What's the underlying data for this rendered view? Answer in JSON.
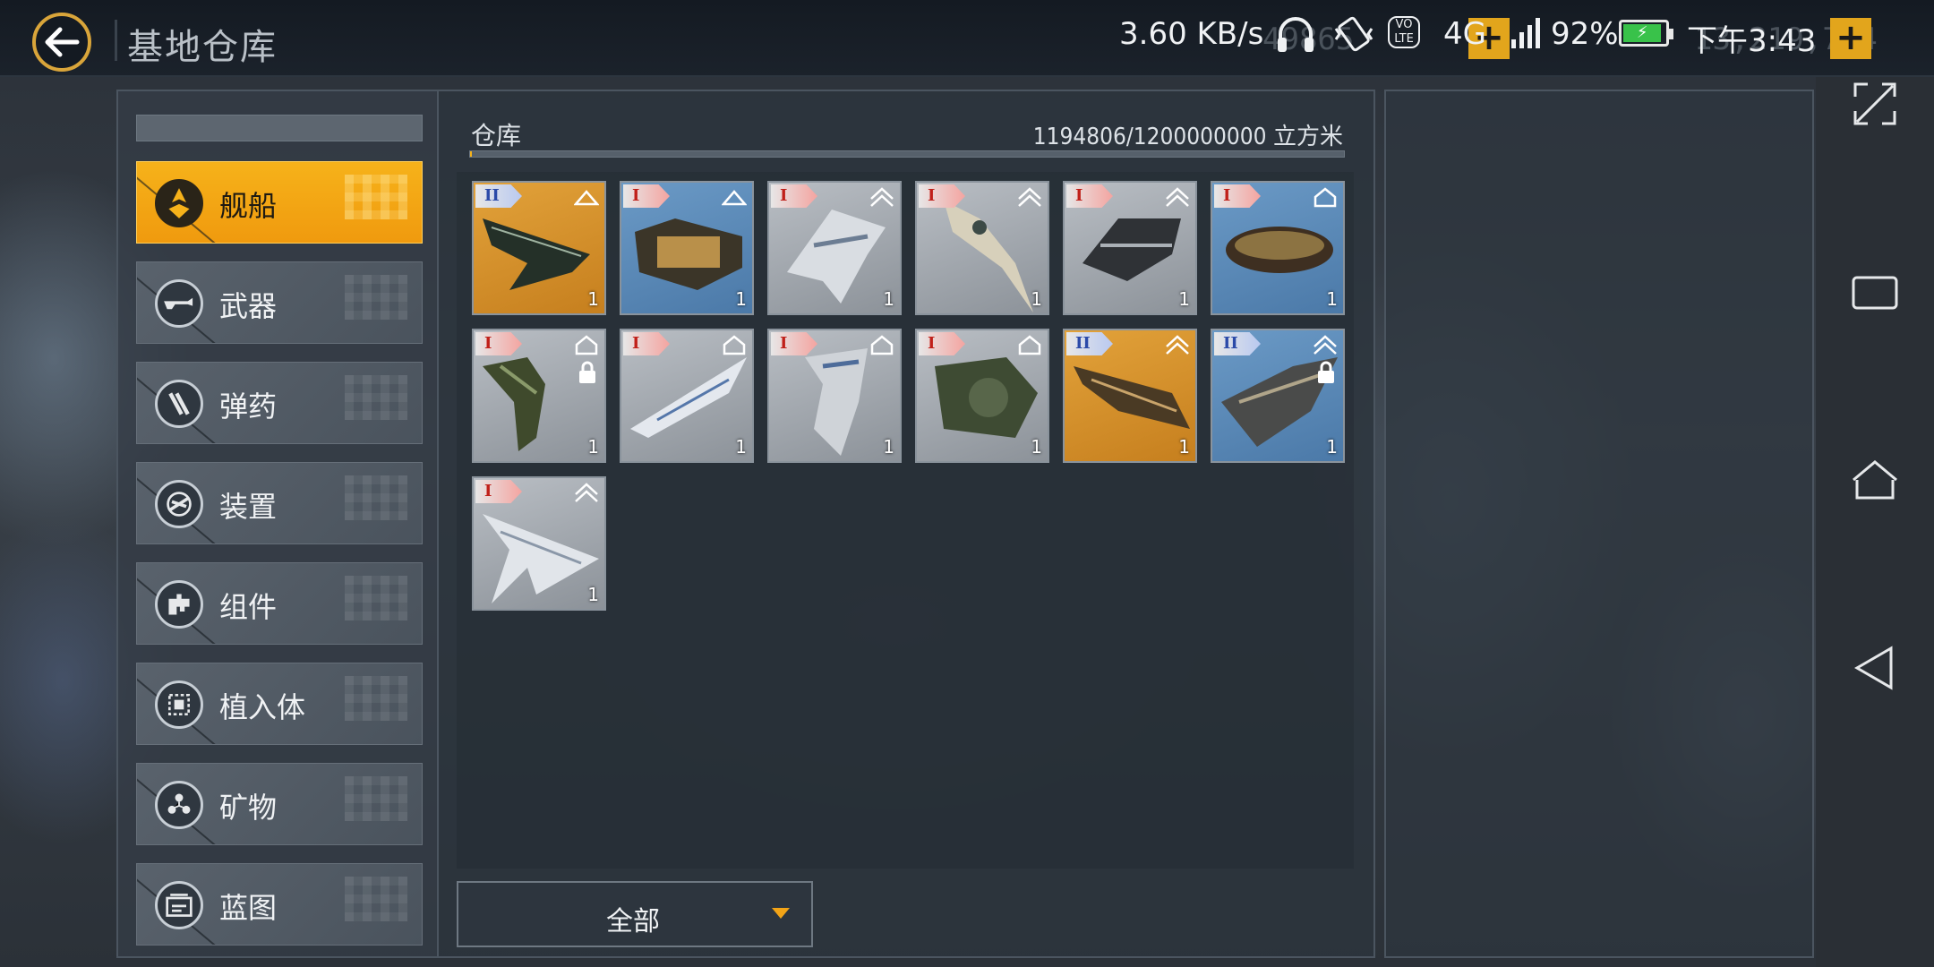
{
  "header": {
    "title": "基地仓库",
    "currency_ghost_left": "49865",
    "currency_ghost_right": "13,219,734"
  },
  "status_bar": {
    "network_speed": "3.60 KB/s",
    "volte_label": "VO LTE",
    "network_type": "4G",
    "battery_percent": "92%",
    "time": "下午3:43"
  },
  "sidebar": {
    "items": [
      {
        "label": "舰船",
        "icon": "ship-category-icon",
        "active": true
      },
      {
        "label": "武器",
        "icon": "weapon-category-icon",
        "active": false
      },
      {
        "label": "弹药",
        "icon": "ammo-category-icon",
        "active": false
      },
      {
        "label": "装置",
        "icon": "device-category-icon",
        "active": false
      },
      {
        "label": "组件",
        "icon": "component-category-icon",
        "active": false
      },
      {
        "label": "植入体",
        "icon": "implant-category-icon",
        "active": false
      },
      {
        "label": "矿物",
        "icon": "mineral-category-icon",
        "active": false
      },
      {
        "label": "蓝图",
        "icon": "blueprint-category-icon",
        "active": false
      }
    ]
  },
  "storage": {
    "label": "仓库",
    "capacity": "1194806/1200000000 立方米",
    "usage_fraction": 0.001
  },
  "items": [
    {
      "tier": "II",
      "bg": "gold",
      "type": "single",
      "qty": "1",
      "locked": false
    },
    {
      "tier": "I",
      "bg": "blue",
      "type": "single",
      "qty": "1",
      "locked": false
    },
    {
      "tier": "I",
      "bg": "gray",
      "type": "double",
      "qty": "1",
      "locked": false
    },
    {
      "tier": "I",
      "bg": "gray",
      "type": "double",
      "qty": "1",
      "locked": false
    },
    {
      "tier": "I",
      "bg": "gray",
      "type": "double",
      "qty": "1",
      "locked": false
    },
    {
      "tier": "I",
      "bg": "blue",
      "type": "house",
      "qty": "1",
      "locked": false
    },
    {
      "tier": "I",
      "bg": "gray",
      "type": "house",
      "qty": "1",
      "locked": true
    },
    {
      "tier": "I",
      "bg": "gray",
      "type": "house",
      "qty": "1",
      "locked": false
    },
    {
      "tier": "I",
      "bg": "gray",
      "type": "house",
      "qty": "1",
      "locked": false
    },
    {
      "tier": "I",
      "bg": "gray",
      "type": "house",
      "qty": "1",
      "locked": false
    },
    {
      "tier": "II",
      "bg": "gold",
      "type": "double",
      "qty": "1",
      "locked": false
    },
    {
      "tier": "II",
      "bg": "blue",
      "type": "double",
      "qty": "1",
      "locked": true
    },
    {
      "tier": "I",
      "bg": "gray",
      "type": "double",
      "qty": "1",
      "locked": false
    }
  ],
  "filter": {
    "selected": "全部"
  },
  "colors": {
    "accent": "#f6b21a",
    "panel": "#2c343d",
    "tier_one_text": "#c0201a",
    "tier_two_text": "#2b4aa8"
  },
  "system_nav": [
    "fullscreen-icon",
    "recents-icon",
    "home-icon",
    "back-icon"
  ]
}
